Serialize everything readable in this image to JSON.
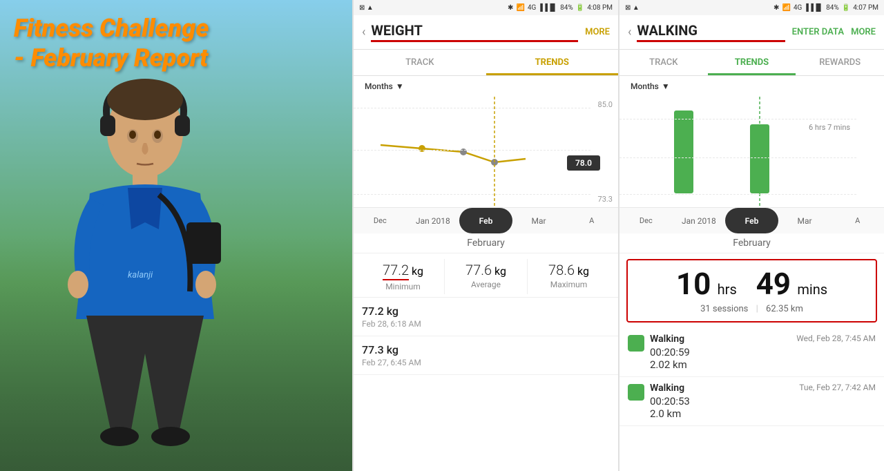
{
  "left": {
    "title_line1": "Fitness Challenge",
    "title_line2": "- February Report"
  },
  "weight_app": {
    "status_bar": {
      "left_icons": "⊠ ▲",
      "time": "4:08 PM",
      "battery": "84%"
    },
    "title": "WEIGHT",
    "back_label": "‹",
    "more_label": "MORE",
    "tabs": [
      "TRACK",
      "TRENDS"
    ],
    "active_tab": "TRENDS",
    "months_label": "Months",
    "chart": {
      "y_labels": [
        "85.0",
        "78.0",
        "73.3"
      ],
      "selected_value": "78.0",
      "x_months": [
        "Dec",
        "Jan 2018",
        "Feb",
        "Mar",
        "A"
      ]
    },
    "month_label": "February",
    "stats": {
      "minimum_value": "77.2",
      "minimum_unit": "kg",
      "minimum_label": "Minimum",
      "average_value": "77.6",
      "average_unit": "kg",
      "average_label": "Average",
      "maximum_value": "78.6",
      "maximum_unit": "kg",
      "maximum_label": "Maximum"
    },
    "log_items": [
      {
        "value": "77.2 kg",
        "date": "Feb 28, 6:18 AM"
      },
      {
        "value": "77.3 kg",
        "date": "Feb 27, 6:45 AM"
      }
    ]
  },
  "walking_app": {
    "status_bar": {
      "left_icons": "⊠ ▲",
      "time": "4:07 PM",
      "battery": "84%"
    },
    "title": "WALKING",
    "back_label": "‹",
    "enter_data_label": "ENTER DATA",
    "more_label": "MORE",
    "tabs": [
      "TRACK",
      "TRENDS",
      "REWARDS"
    ],
    "active_tab": "TRENDS",
    "months_label": "Months",
    "chart": {
      "y_label_right": "6 hrs 7 mins",
      "x_months": [
        "Dec",
        "Jan 2018",
        "Feb",
        "Mar",
        "A"
      ]
    },
    "month_label": "February",
    "total": {
      "hours": "10",
      "hrs_label": "hrs",
      "mins": "49",
      "mins_label": "mins",
      "sessions": "31 sessions",
      "separator": "|",
      "distance": "62.35 km"
    },
    "log_items": [
      {
        "title": "Walking",
        "date": "Wed, Feb 28, 7:45 AM",
        "time": "00:20:59",
        "distance": "2.02 km"
      },
      {
        "title": "Walking",
        "date": "Tue, Feb 27, 7:42 AM",
        "time": "00:20:53",
        "distance": "2.0 km"
      }
    ]
  }
}
